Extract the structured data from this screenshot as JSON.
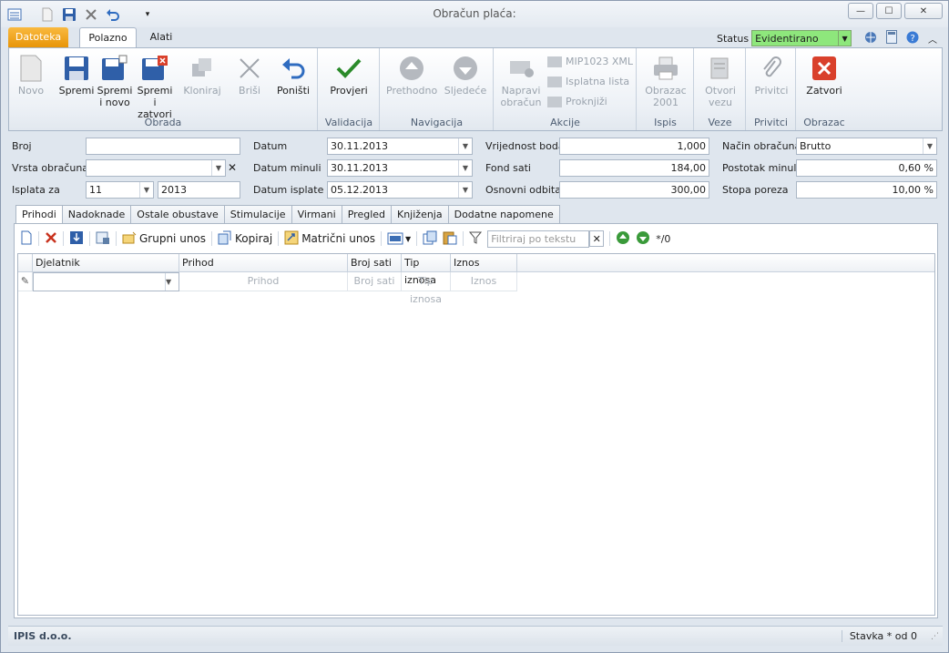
{
  "window": {
    "title": "Obračun plaća:",
    "min": "—",
    "max": "☐",
    "close": "✕"
  },
  "tabs": {
    "file": "Datoteka",
    "home": "Polazno",
    "tools": "Alati"
  },
  "status": {
    "label": "Status",
    "value": "Evidentirano"
  },
  "ribbon": {
    "obrada": {
      "label": "Obrada",
      "novo": "Novo",
      "spremi": "Spremi",
      "spremi_novo": "Spremi i novo",
      "spremi_zatvori": "Spremi i zatvori",
      "kloniraj": "Kloniraj",
      "brisi": "Briši",
      "ponisti": "Poništi"
    },
    "validacija": {
      "label": "Validacija",
      "provjeri": "Provjeri"
    },
    "navigacija": {
      "label": "Navigacija",
      "prethodno": "Prethodno",
      "sljedece": "Sljedeće"
    },
    "akcije": {
      "label": "Akcije",
      "napravi": "Napravi obračun",
      "mip": "MIP1023 XML",
      "isplatna": "Isplatna lista",
      "proknjizi": "Proknjiži"
    },
    "ispis": {
      "label": "Ispis",
      "obrazac": "Obrazac 2001"
    },
    "veze": {
      "label": "Veze",
      "otvori": "Otvori vezu"
    },
    "privitci": {
      "label": "Privitci",
      "privitci": "Privitci"
    },
    "obrazac": {
      "label": "Obrazac",
      "zatvori": "Zatvori"
    }
  },
  "form": {
    "broj": {
      "label": "Broj",
      "value": ""
    },
    "vrsta": {
      "label": "Vrsta obračuna",
      "value": ""
    },
    "isplata": {
      "label": "Isplata za",
      "month": "11",
      "year": "2013"
    },
    "datum": {
      "label": "Datum",
      "value": "30.11.2013"
    },
    "datum_minuli": {
      "label": "Datum minuli",
      "value": "30.11.2013"
    },
    "datum_isplate": {
      "label": "Datum isplate",
      "value": "05.12.2013"
    },
    "vrijednost_boda": {
      "label": "Vrijednost boda",
      "value": "1,000"
    },
    "fond_sati": {
      "label": "Fond sati",
      "value": "184,00"
    },
    "osnovni_odbitak": {
      "label": "Osnovni odbitak",
      "value": "300,00"
    },
    "nacin": {
      "label": "Način obračuna",
      "value": "Brutto"
    },
    "postotak_minuli": {
      "label": "Postotak minuli",
      "value": "0,60 %"
    },
    "stopa_poreza": {
      "label": "Stopa poreza",
      "value": "10,00 %"
    }
  },
  "page_tabs": [
    "Prihodi",
    "Nadoknade",
    "Ostale obustave",
    "Stimulacije",
    "Virmani",
    "Pregled",
    "Knjiženja",
    "Dodatne napomene"
  ],
  "grid_toolbar": {
    "grupni": "Grupni unos",
    "kopiraj": "Kopiraj",
    "matricni": "Matrični unos",
    "filter_placeholder": "Filtriraj po tekstu",
    "counter": "*/0"
  },
  "grid": {
    "columns": [
      "Djelatnik",
      "Prihod",
      "Broj sati",
      "Tip iznosa",
      "Iznos"
    ],
    "new_row": [
      "",
      "Prihod",
      "Broj sati",
      "Tip iznosa",
      "Iznos"
    ]
  },
  "statusbar": {
    "company": "IPIS d.o.o.",
    "item": "Stavka * od 0"
  },
  "colors": {
    "accent": "#e89508",
    "status_green": "#8ee77c"
  }
}
